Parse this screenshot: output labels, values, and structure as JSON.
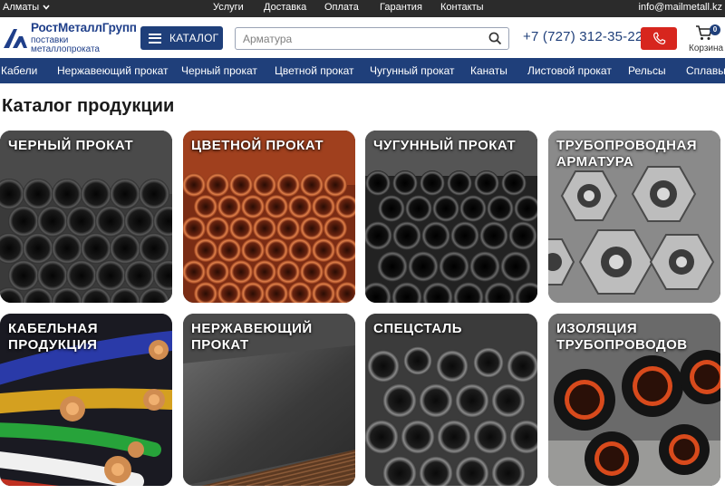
{
  "topbar": {
    "city": "Алматы",
    "links": [
      "Услуги",
      "Доставка",
      "Оплата",
      "Гарантия",
      "Контакты"
    ],
    "email": "info@mailmetall.kz"
  },
  "header": {
    "logo_name": "РостМеталлГрупп",
    "logo_sub": "поставки металлопроката",
    "catalog_label": "КАТАЛОГ",
    "search_placeholder": "Арматура",
    "phone": "+7 (727) 312-35-22",
    "cart_label": "Корзина",
    "cart_count": "0"
  },
  "nav": [
    "Кабели",
    "Нержавеющий прокат",
    "Черный прокат",
    "Цветной прокат",
    "Чугунный прокат",
    "Канаты",
    "Листовой прокат",
    "Рельсы",
    "Сплавы"
  ],
  "page_title": "Каталог продукции",
  "categories": [
    "ЧЕРНЫЙ ПРОКАТ",
    "ЦВЕТНОЙ ПРОКАТ",
    "ЧУГУННЫЙ ПРОКАТ",
    "ТРУБОПРОВОДНАЯ АРМАТУРА",
    "КАБЕЛЬНАЯ ПРОДУКЦИЯ",
    "НЕРЖАВЕЮЩИЙ ПРОКАТ",
    "СПЕЦСТАЛЬ",
    "ИЗОЛЯЦИЯ ТРУБОПРОВОДОВ"
  ],
  "colors": {
    "brand_blue": "#1f3f7a",
    "topbar": "#2b2b2b",
    "call_red": "#d7261e"
  },
  "icons": [
    "chevron-down-icon",
    "logo-icon",
    "menu-icon",
    "search-icon",
    "phone-icon",
    "cart-icon"
  ]
}
